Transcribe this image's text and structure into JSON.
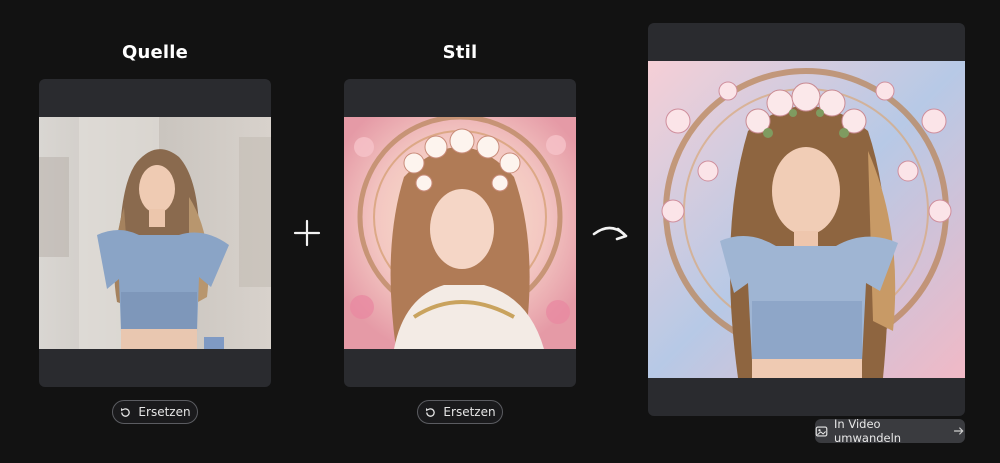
{
  "source": {
    "title": "Quelle",
    "replace_label": "Ersetzen"
  },
  "style": {
    "title": "Stil",
    "replace_label": "Ersetzen"
  },
  "result": {
    "convert_label": "In Video umwandeln"
  },
  "icons": {
    "plus": "plus-icon",
    "arrow": "curved-arrow-icon",
    "replace": "rotate-icon",
    "video": "image-to-video-icon",
    "right_arrow": "arrow-right-icon"
  },
  "colors": {
    "background": "#121212",
    "card": "#2a2b2f",
    "button_border": "#5b5c61",
    "cta_bg": "#3a3b3f"
  }
}
